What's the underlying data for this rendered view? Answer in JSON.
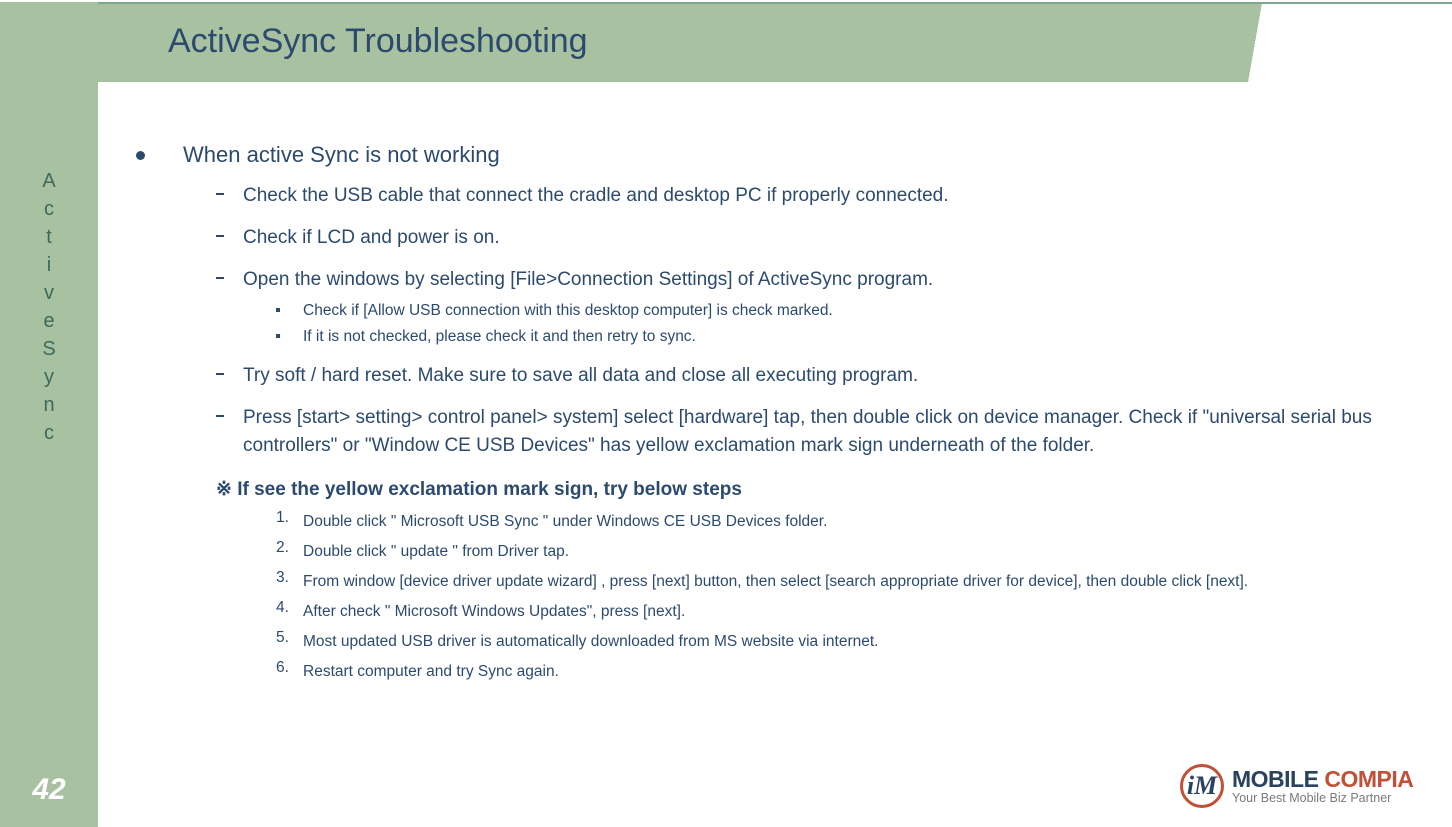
{
  "sidebar": {
    "label_chars": [
      "A",
      "c",
      "t",
      "i",
      "v",
      "e",
      "S",
      "y",
      "n",
      "c"
    ],
    "page_number": "42"
  },
  "title": "ActiveSync Troubleshooting",
  "bullets": {
    "lvl1": "When active Sync is not working",
    "lvl2": [
      "Check the USB cable that connect the cradle and desktop PC if properly connected.",
      "Check if LCD and power is on.",
      "Open the windows by selecting [File>Connection Settings] of ActiveSync program.",
      "Try soft / hard reset. Make sure to save all data and close all executing program.",
      "Press [start> setting> control panel> system] select [hardware] tap, then double click on device manager. Check if \"universal serial bus controllers\"  or \"Window CE USB Devices\" has yellow  exclamation mark sign underneath of the folder."
    ],
    "lvl3": [
      "Check if [Allow USB connection with this desktop computer] is check marked.",
      "If it is not checked, please check it and then retry to sync."
    ],
    "note": "※ If see the yellow exclamation mark sign, try below steps",
    "steps": [
      "Double click \" Microsoft USB Sync \" under Windows CE USB Devices folder.",
      "Double click \" update \" from Driver tap.",
      "From window [device driver update wizard] , press [next] button, then select [search appropriate driver for device], then double click [next].",
      "After check \" Microsoft Windows Updates\", press [next].",
      "Most updated USB driver is automatically downloaded from MS website via internet.",
      "Restart computer and try Sync again."
    ]
  },
  "logo": {
    "mark": "iM",
    "line1a": "MOBILE ",
    "line1b": "COMPIA",
    "line2": "Your Best Mobile Biz Partner"
  }
}
